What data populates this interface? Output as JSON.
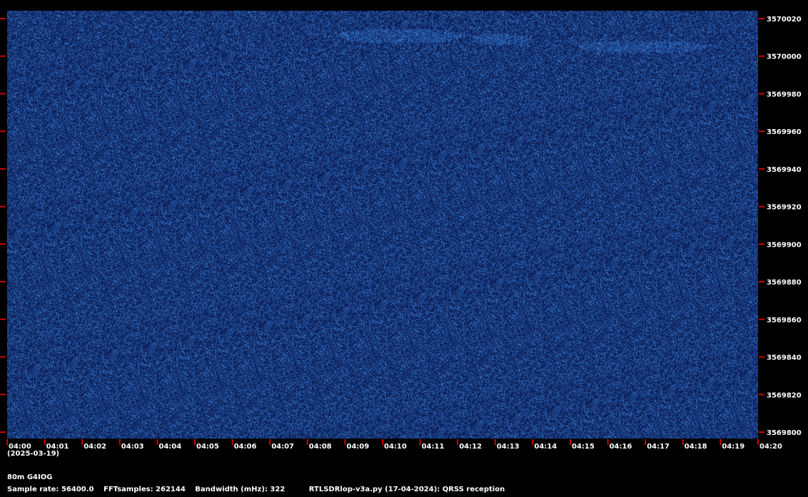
{
  "chart_data": {
    "type": "heatmap",
    "x_tick_labels": [
      "04:00",
      "04:01",
      "04:02",
      "04:03",
      "04:04",
      "04:05",
      "04:06",
      "04:07",
      "04:08",
      "04:09",
      "04:10",
      "04:11",
      "04:12",
      "04:13",
      "04:14",
      "04:15",
      "04:16",
      "04:17",
      "04:18",
      "04:19",
      "04:20"
    ],
    "y_tick_labels": [
      "3570020",
      "3570000",
      "3569980",
      "3569960",
      "3569940",
      "3569920",
      "3569900",
      "3569880",
      "3569860",
      "3569840",
      "3569820",
      "3569800"
    ],
    "y_range": [
      3569800,
      3570020
    ],
    "colors": {
      "background": "#0a1a52",
      "signal": "#3a7ad8",
      "tick": "#d00000"
    }
  },
  "date_label": "(2025-03-19)",
  "station": "80m G4IOG",
  "info": {
    "sample_rate": "Sample rate: 56400.0",
    "fft": "FFTsamples: 262144",
    "bandwidth": "Bandwidth (mHz): 322",
    "program": "RTLSDRlop-v3a.py (17-04-2024): QRSS reception"
  }
}
